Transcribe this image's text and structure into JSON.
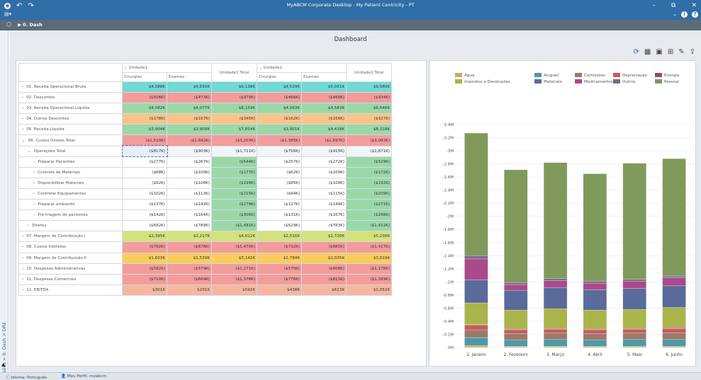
{
  "window": {
    "title": "MyABCM Corporate Desktop - My Patient Centricity - PT",
    "controls": {
      "minimize": "–",
      "restore": "⧉",
      "close": "✕"
    },
    "help_icons": [
      "⌄",
      "i",
      "?"
    ]
  },
  "breadcrumb": {
    "label": "0. Dash"
  },
  "side_tab": {
    "label": "Visões > 0. Dash > DRE"
  },
  "dashboard": {
    "title": "Dashboard"
  },
  "pivot": {
    "group1": "Unidade1",
    "group2": "Unidade2",
    "total1": "Unidade1 Total",
    "total2": "Unidade2 Total",
    "sub_cols": [
      "Cirurgias",
      "Exames"
    ],
    "rows": [
      {
        "label": "01. Receita Operacional Bruta",
        "indent": 0,
        "expander": "›",
        "vals": [
          "$4,588K",
          "$4,550K",
          "$9,138K",
          "$4,529K",
          "$5,051K",
          "$9,580K"
        ],
        "colors": [
          "cyan",
          "cyan",
          "cyan",
          "cyan",
          "cyan",
          "cyan"
        ]
      },
      {
        "label": "02. Descontos",
        "indent": 0,
        "expander": "›",
        "vals": [
          "($506K)",
          "($473K)",
          "($979K)",
          "($466K)",
          "($468K)",
          "($934K)"
        ],
        "colors": [
          "red",
          "red",
          "red",
          "red",
          "red",
          "red"
        ]
      },
      {
        "label": "03. Receita Operacional Líquida",
        "indent": 0,
        "expander": "›",
        "vals": [
          "$4,082K",
          "$4,077K",
          "$8,159K",
          "$4,063K",
          "$4,583K",
          "$8,646K"
        ],
        "colors": [
          "green",
          "green",
          "green",
          "green",
          "green",
          "green"
        ]
      },
      {
        "label": "04. Outros Descontos",
        "indent": 0,
        "expander": "›",
        "vals": [
          "($178K)",
          "($167K)",
          "($345K)",
          "($162K)",
          "($166K)",
          "($327K)"
        ],
        "colors": [
          "orange",
          "orange",
          "orange",
          "orange",
          "orange",
          "orange"
        ]
      },
      {
        "label": "05. Receita Líquida",
        "indent": 0,
        "expander": "›",
        "vals": [
          "$3,904K",
          "$3,909K",
          "$7,814K",
          "$3,901K",
          "$4,418K",
          "$8,318K"
        ],
        "colors": [
          "green",
          "green",
          "green",
          "green",
          "green",
          "green"
        ]
      },
      {
        "label": "06. Custos Diretos Total",
        "indent": 0,
        "expander": "⌄",
        "vals": [
          "($1,510K)",
          "($1,692K)",
          "($3,203K)",
          "($1,385K)",
          "($1,697K)",
          "($3,083K)"
        ],
        "colors": [
          "red",
          "red",
          "red",
          "red",
          "red",
          "red"
        ]
      },
      {
        "label": "Operações Total",
        "indent": 1,
        "expander": "⌄",
        "vals": [
          "($817K)",
          "($903K)",
          "($1,721K)",
          "($756K)",
          "($915K)",
          "($1,671K)"
        ],
        "colors": [
          "sel",
          "light",
          "light",
          "light",
          "light",
          "light"
        ]
      },
      {
        "label": "Preparar Pacientes",
        "indent": 2,
        "expander": "›",
        "vals": [
          "($277K)",
          "($267K)",
          "($544K)",
          "($257K)",
          "($272K)",
          "($529K)"
        ],
        "colors": [
          "white",
          "white",
          "green",
          "white",
          "white",
          "green"
        ]
      },
      {
        "label": "Controle de Materiais",
        "indent": 2,
        "expander": "›",
        "vals": [
          "($68K)",
          "($109K)",
          "($177K)",
          "($62K)",
          "($109K)",
          "($172K)"
        ],
        "colors": [
          "white",
          "white",
          "green",
          "white",
          "white",
          "green"
        ]
      },
      {
        "label": "Disponibilizar Materiais",
        "indent": 2,
        "expander": "›",
        "vals": [
          "($92K)",
          "($108K)",
          "($199K)",
          "($85K)",
          "($108K)",
          "($192K)"
        ],
        "colors": [
          "white",
          "white",
          "green",
          "white",
          "white",
          "green"
        ]
      },
      {
        "label": "Controlar Equipamentos",
        "indent": 2,
        "expander": "›",
        "vals": [
          "($102K)",
          "($113K)",
          "($215K)",
          "($94K)",
          "($115K)",
          "($209K)"
        ],
        "colors": [
          "white",
          "white",
          "green",
          "white",
          "white",
          "green"
        ]
      },
      {
        "label": "Preparar ambiente",
        "indent": 2,
        "expander": "›",
        "vals": [
          "($137K)",
          "($142K)",
          "($279K)",
          "($127K)",
          "($144K)",
          "($271K)"
        ],
        "colors": [
          "white",
          "white",
          "green",
          "white",
          "white",
          "green"
        ]
      },
      {
        "label": "Pré-triagem de pacientes",
        "indent": 2,
        "expander": "›",
        "vals": [
          "($142K)",
          "($164K)",
          "($306K)",
          "($131K)",
          "($167K)",
          "($298K)"
        ],
        "colors": [
          "white",
          "white",
          "green",
          "white",
          "white",
          "green"
        ]
      },
      {
        "label": "Diretos",
        "indent": 1,
        "expander": "›",
        "vals": [
          "($692K)",
          "($789K)",
          "($1,481K)",
          "($629K)",
          "($783K)",
          "($1,412K)"
        ],
        "colors": [
          "white",
          "white",
          "green",
          "white",
          "white",
          "green"
        ]
      },
      {
        "label": "07. Margem de Contribuição I",
        "indent": 0,
        "expander": "›",
        "vals": [
          "$2,395K",
          "$2,217K",
          "$4,612K",
          "$2,516K",
          "$2,720K",
          "$5,236K"
        ],
        "colors": [
          "yellowg",
          "yellowg",
          "yellowg",
          "yellowg",
          "yellowg",
          "yellowg"
        ]
      },
      {
        "label": "08. Custos Indiretos",
        "indent": 0,
        "expander": "›",
        "vals": [
          "($792K)",
          "($678K)",
          "($1,470K)",
          "($732K)",
          "($685K)",
          "($1,417K)"
        ],
        "colors": [
          "red",
          "red",
          "red",
          "red",
          "red",
          "red"
        ]
      },
      {
        "label": "09. Margem de Contribuição II",
        "indent": 0,
        "expander": "›",
        "vals": [
          "$1,603K",
          "$1,539K",
          "$3,142K",
          "$1,784K",
          "$2,035K",
          "$3,819K"
        ],
        "colors": [
          "amber",
          "amber",
          "amber",
          "amber",
          "amber",
          "amber"
        ]
      },
      {
        "label": "10. Despesas Administrativas",
        "indent": 0,
        "expander": "›",
        "vals": [
          "($592K)",
          "($579K)",
          "($1,171K)",
          "($570K)",
          "($608K)",
          "($1,178K)"
        ],
        "colors": [
          "red",
          "red",
          "red",
          "red",
          "red",
          "red"
        ]
      },
      {
        "label": "11. Despesas Comerciais",
        "indent": 0,
        "expander": "›",
        "vals": [
          "($710K)",
          "($669K)",
          "($1,378K)",
          "($776K)",
          "($813K)",
          "($1,589K)"
        ],
        "colors": [
          "red",
          "red",
          "red",
          "red",
          "red",
          "red"
        ]
      },
      {
        "label": "12. EBITDA",
        "indent": 0,
        "expander": "›",
        "vals": [
          "$301K",
          "$291K",
          "$592K",
          "$438K",
          "$613K",
          "$1,052K"
        ],
        "colors": [
          "salmon",
          "salmon",
          "salmon",
          "salmon",
          "salmon",
          "salmon"
        ]
      }
    ]
  },
  "status": {
    "language": "Idioma: Português",
    "profile": "Meu Perfil: myabcm"
  },
  "colors": {
    "accent": "#2f6ea6",
    "cyan": "#72d9d5",
    "red": "#f39c9c",
    "green": "#9bd8a8",
    "orange": "#f9c48a",
    "yellowg": "#d4e27c",
    "amber": "#f9cd5b",
    "salmon": "#f5b7a0"
  },
  "chart_data": {
    "type": "bar",
    "stacked": true,
    "categories": [
      "1. Janeiro",
      "2. Fevereiro",
      "3. Março",
      "4. Abril",
      "5. Maio",
      "6. Junho"
    ],
    "ylim": [
      0,
      3.4
    ],
    "y_ticks": [
      "0M",
      "-0.2M",
      "-0.4M",
      "-0.6M",
      "-0.8M",
      "-1M",
      "-1.2M",
      "-1.4M",
      "-1.6M",
      "-1.8M",
      "-2M",
      "-2.2M",
      "-2.4M",
      "-2.6M",
      "-2.8M",
      "-3M",
      "-3.2M",
      "-3.4M"
    ],
    "legend_position": "top",
    "series": [
      {
        "name": "Água",
        "color": "#c8a86a",
        "values": [
          0.03,
          0.02,
          0.02,
          0.02,
          0.02,
          0.02
        ]
      },
      {
        "name": "Aluguel",
        "color": "#4a9aa8",
        "values": [
          0.12,
          0.09,
          0.1,
          0.09,
          0.1,
          0.1
        ]
      },
      {
        "name": "Comissões",
        "color": "#9a7a6a",
        "values": [
          0.12,
          0.1,
          0.1,
          0.1,
          0.1,
          0.1
        ]
      },
      {
        "name": "Depreciação",
        "color": "#c85a5a",
        "values": [
          0.07,
          0.06,
          0.06,
          0.06,
          0.06,
          0.07
        ]
      },
      {
        "name": "Energia",
        "color": "#9a4a6a",
        "values": [
          0.01,
          0.01,
          0.01,
          0.01,
          0.01,
          0.01
        ]
      },
      {
        "name": "Impostos e Devoluções",
        "color": "#a9b44a",
        "values": [
          0.33,
          0.29,
          0.3,
          0.29,
          0.29,
          0.31
        ]
      },
      {
        "name": "Materiais",
        "color": "#5a6a9a",
        "values": [
          0.35,
          0.3,
          0.32,
          0.31,
          0.32,
          0.33
        ]
      },
      {
        "name": "Medicamentos",
        "color": "#a94a8a",
        "values": [
          0.32,
          0.09,
          0.11,
          0.1,
          0.11,
          0.12
        ]
      },
      {
        "name": "Outros",
        "color": "#7a6a8a",
        "values": [
          0.05,
          0.03,
          0.03,
          0.03,
          0.03,
          0.03
        ]
      },
      {
        "name": "Pessoal",
        "color": "#7f9a5a",
        "values": [
          1.87,
          1.72,
          1.77,
          1.64,
          1.77,
          1.79
        ]
      }
    ]
  }
}
